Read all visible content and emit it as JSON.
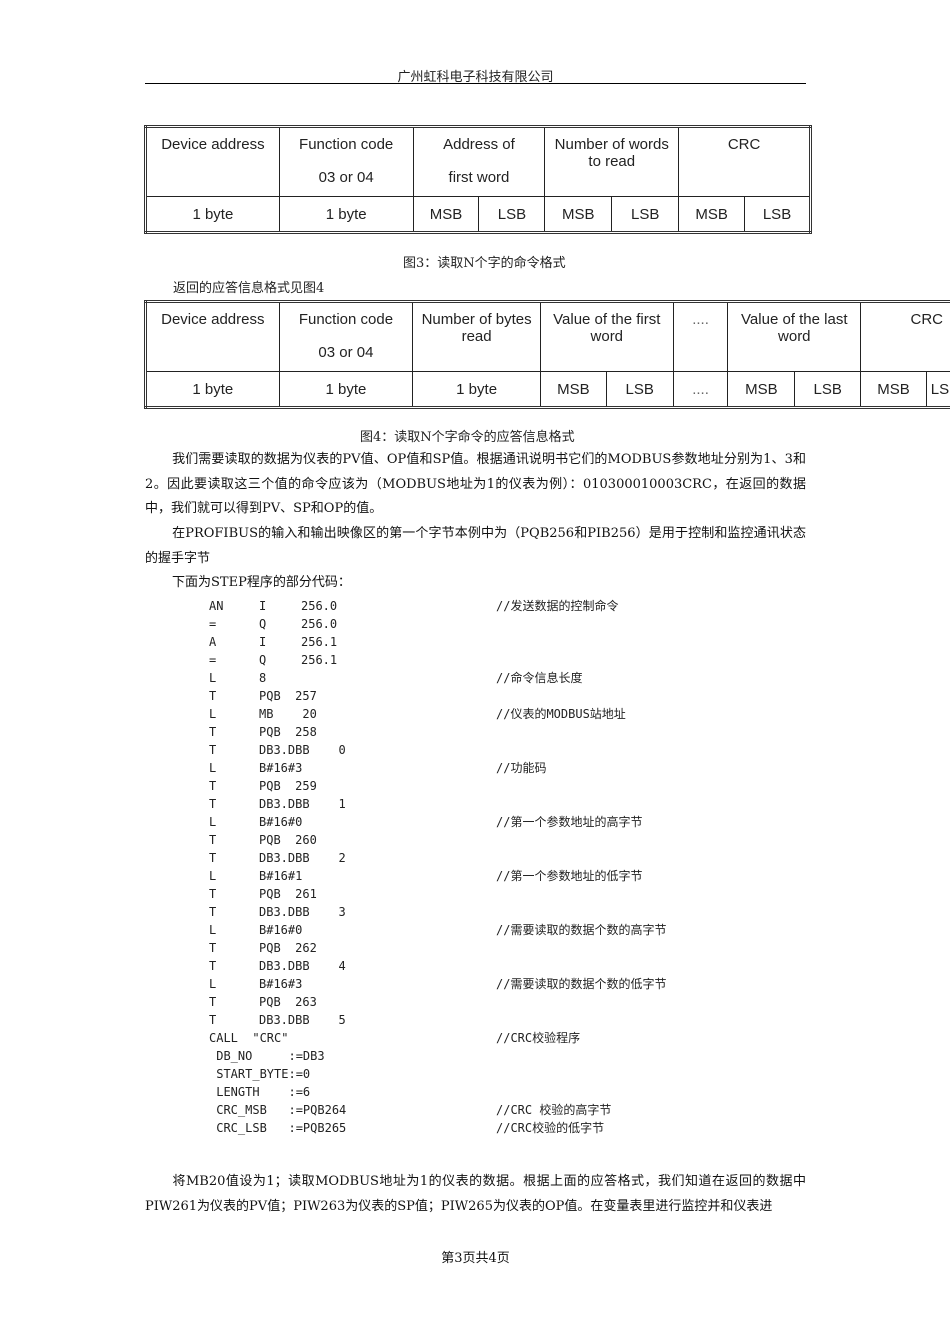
{
  "header": {
    "company": "广州虹科电子科技有限公司"
  },
  "table1": {
    "top": [
      {
        "l1": "Device address",
        "l2": ""
      },
      {
        "l1": "Function code",
        "l2": "03 or 04"
      },
      {
        "l1": "Address of",
        "l2": "first word"
      },
      {
        "l1": "Number of words to read",
        "l2": ""
      },
      {
        "l1": "CRC",
        "l2": ""
      }
    ],
    "bottom": [
      "1 byte",
      "1 byte",
      "MSB",
      "LSB",
      "MSB",
      "LSB",
      "MSB",
      "LSB"
    ],
    "caption": "图3：读取N个字的命令格式"
  },
  "intro_table2": "返回的应答信息格式见图4",
  "table2": {
    "top": [
      {
        "l1": "Device address",
        "l2": ""
      },
      {
        "l1": "Function code",
        "l2": "03 or 04"
      },
      {
        "l1": "Number of bytes read",
        "l2": ""
      },
      {
        "l1": "Value of the first word",
        "l2": ""
      },
      {
        "l1": "....",
        "l2": ""
      },
      {
        "l1": "Value of the last word",
        "l2": ""
      },
      {
        "l1": "CRC",
        "l2": ""
      }
    ],
    "bottom": [
      "1 byte",
      "1 byte",
      "1 byte",
      "MSB",
      "LSB",
      "....",
      "MSB",
      "LSB",
      "MSB",
      "LSB"
    ],
    "caption": "图4：读取N个字命令的应答信息格式"
  },
  "para1": "我们需要读取的数据为仪表的PV值、OP值和SP值。根据通讯说明书它们的MODBUS参数地址分别为1、3和2。因此要读取这三个值的命令应该为（MODBUS地址为1的仪表为例）：010300010003CRC，在返回的数据中，我们就可以得到PV、SP和OP的值。",
  "para2": "在PROFIBUS的输入和输出映像区的第一个字节本例中为（PQB256和PIB256）是用于控制和监控通讯状态的握手字节",
  "para3": "下面为STEP程序的部分代码：",
  "code": [
    {
      "op": "AN",
      "a": "I",
      "b": "256.0",
      "c": "//发送数据的控制命令"
    },
    {
      "op": "=",
      "a": "Q",
      "b": "256.0",
      "c": ""
    },
    {
      "op": "A",
      "a": "I",
      "b": "256.1",
      "c": ""
    },
    {
      "op": "=",
      "a": "Q",
      "b": "256.1",
      "c": ""
    },
    {
      "op": "L",
      "a": "8",
      "b": "",
      "c": "//命令信息长度"
    },
    {
      "op": "T",
      "a": "PQB  257",
      "b": "",
      "c": ""
    },
    {
      "op": "L",
      "a": "MB    20",
      "b": "",
      "c": "//仪表的MODBUS站地址"
    },
    {
      "op": "T",
      "a": "PQB  258",
      "b": "",
      "c": ""
    },
    {
      "op": "T",
      "a": "DB3.DBB    0",
      "b": "",
      "c": ""
    },
    {
      "op": "L",
      "a": "B#16#3",
      "b": "",
      "c": "//功能码"
    },
    {
      "op": "T",
      "a": "PQB  259",
      "b": "",
      "c": ""
    },
    {
      "op": "T",
      "a": "DB3.DBB    1",
      "b": "",
      "c": ""
    },
    {
      "op": "L",
      "a": "B#16#0",
      "b": "",
      "c": "//第一个参数地址的高字节"
    },
    {
      "op": "T",
      "a": "PQB  260",
      "b": "",
      "c": ""
    },
    {
      "op": "T",
      "a": "DB3.DBB    2",
      "b": "",
      "c": ""
    },
    {
      "op": "L",
      "a": "B#16#1",
      "b": "",
      "c": "//第一个参数地址的低字节"
    },
    {
      "op": "T",
      "a": "PQB  261",
      "b": "",
      "c": ""
    },
    {
      "op": "T",
      "a": "DB3.DBB    3",
      "b": "",
      "c": ""
    },
    {
      "op": "L",
      "a": "B#16#0",
      "b": "",
      "c": "//需要读取的数据个数的高字节"
    },
    {
      "op": "T",
      "a": "PQB  262",
      "b": "",
      "c": ""
    },
    {
      "op": "T",
      "a": "DB3.DBB    4",
      "b": "",
      "c": ""
    },
    {
      "op": "L",
      "a": "B#16#3",
      "b": "",
      "c": "//需要读取的数据个数的低字节"
    },
    {
      "op": "T",
      "a": "PQB  263",
      "b": "",
      "c": ""
    },
    {
      "op": "T",
      "a": "DB3.DBB    5",
      "b": "",
      "c": ""
    },
    {
      "op": "CALL  \"CRC\"",
      "a": "",
      "b": "",
      "c": "//CRC校验程序"
    },
    {
      "op": " DB_NO     :=DB3",
      "a": "",
      "b": "",
      "c": ""
    },
    {
      "op": " START_BYTE:=0",
      "a": "",
      "b": "",
      "c": ""
    },
    {
      "op": " LENGTH    :=6",
      "a": "",
      "b": "",
      "c": ""
    },
    {
      "op": " CRC_MSB   :=PQB264",
      "a": "",
      "b": "",
      "c": "//CRC 校验的高字节"
    },
    {
      "op": " CRC_LSB   :=PQB265",
      "a": "",
      "b": "",
      "c": "//CRC校验的低字节"
    }
  ],
  "para4": "将MB20值设为1；读取MODBUS地址为1的仪表的数据。根据上面的应答格式，我们知道在返回的数据中PIW261为仪表的PV值；PIW263为仪表的SP值；PIW265为仪表的OP值。在变量表里进行监控并和仪表进",
  "footer": "第3页共4页"
}
